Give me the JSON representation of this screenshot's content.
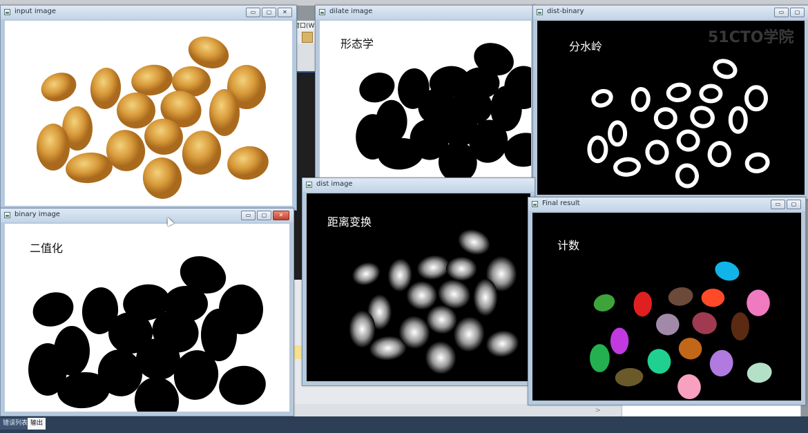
{
  "ide": {
    "menu_label": "窗口(W",
    "bottom_tabs": [
      "错误列表",
      "输出"
    ]
  },
  "windows": {
    "input": {
      "title": "input image"
    },
    "dilate": {
      "title": "dilate image",
      "label": "形态学"
    },
    "dist_binary": {
      "title": "dist-binary",
      "label": "分水岭"
    },
    "binary": {
      "title": "binary image",
      "label": "二值化"
    },
    "dist": {
      "title": "dist image",
      "label": "距离变换"
    },
    "final": {
      "title": "Final result",
      "label": "计数"
    }
  },
  "watermark": "51CTO学院",
  "window_buttons": {
    "minimize": "▭",
    "maximize": "▢",
    "close": "✕"
  },
  "colors": {
    "titlebar": "#c2d4e6",
    "close_button": "#c4402d",
    "kernel": "#d89a3a",
    "kernel_dark": "#a96a1e",
    "segments": [
      "#3ea33a",
      "#e02020",
      "#6b4a3a",
      "#ff4a2a",
      "#10b4e8",
      "#f07ac0",
      "#c03ae0",
      "#a08aa8",
      "#a03a50",
      "#5a2a12",
      "#24b050",
      "#6a5a2a",
      "#20d090",
      "#c2661a",
      "#b07ae0",
      "#f7a0c0",
      "#b4e0c8"
    ]
  }
}
